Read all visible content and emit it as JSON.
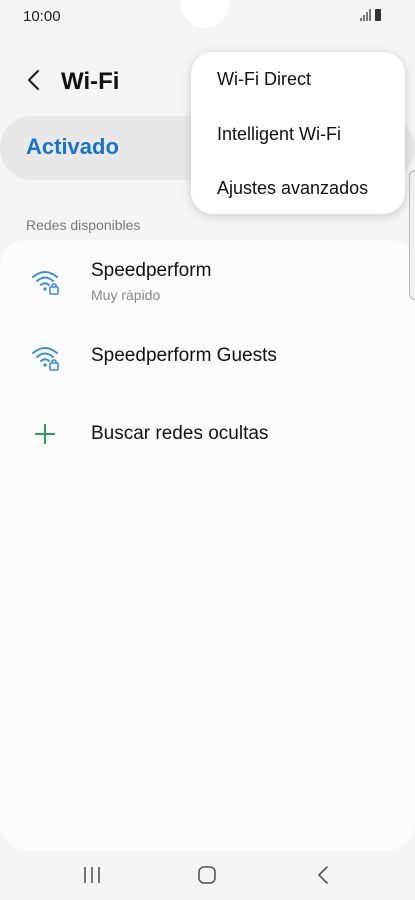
{
  "status_bar": {
    "time": "10:00"
  },
  "header": {
    "title": "Wi-Fi",
    "back_icon": "chevron-left-icon"
  },
  "toggle": {
    "label": "Activado"
  },
  "section": {
    "available_label": "Redes disponibles"
  },
  "networks": [
    {
      "name": "Speedperform",
      "subtitle": "Muy rápido",
      "icon": "wifi-lock-icon"
    },
    {
      "name": "Speedperform Guests",
      "subtitle": "",
      "icon": "wifi-lock-icon"
    }
  ],
  "add_network": {
    "label": "Buscar redes ocultas",
    "icon": "plus-icon"
  },
  "menu": {
    "items": [
      {
        "label": "Wi-Fi Direct"
      },
      {
        "label": "Intelligent Wi-Fi"
      },
      {
        "label": "Ajustes avanzados"
      }
    ]
  },
  "nav": {
    "recent_icon": "recent-apps-icon",
    "home_icon": "home-icon",
    "back_icon": "back-icon"
  },
  "colors": {
    "accent": "#1a73c8",
    "wifi_icon": "#3b8ddd",
    "plus_icon": "#2aa14a"
  }
}
